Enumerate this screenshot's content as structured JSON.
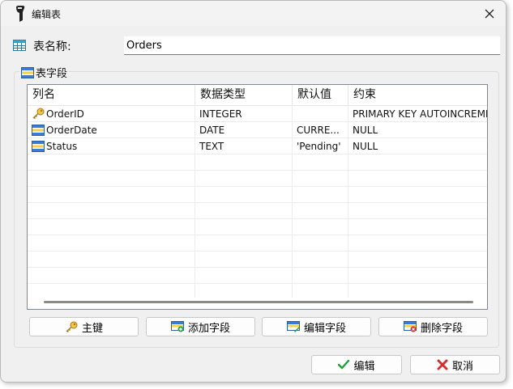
{
  "window": {
    "title": "编辑表"
  },
  "table_name": {
    "label": "表名称:",
    "value": "Orders"
  },
  "fields_group": {
    "label": "表字段"
  },
  "columns": [
    "列名",
    "数据类型",
    "默认值",
    "约束"
  ],
  "rows": [
    {
      "icon": "key-icon",
      "name": "OrderID",
      "type": "INTEGER",
      "default": "",
      "constraint": "PRIMARY KEY AUTOINCREME"
    },
    {
      "icon": "field-icon",
      "name": "OrderDate",
      "type": "DATE",
      "default": "CURRE...",
      "constraint": "NULL"
    },
    {
      "icon": "field-icon",
      "name": "Status",
      "type": "TEXT",
      "default": "'Pending'",
      "constraint": "NULL"
    }
  ],
  "field_buttons": {
    "primary_key": "主键",
    "add": "添加字段",
    "edit": "编辑字段",
    "delete": "删除字段"
  },
  "dialog_buttons": {
    "ok": "编辑",
    "cancel": "取消"
  },
  "colors": {
    "accent": "#0a7d2c",
    "danger": "#d32f2f",
    "key": "#e0b020"
  }
}
